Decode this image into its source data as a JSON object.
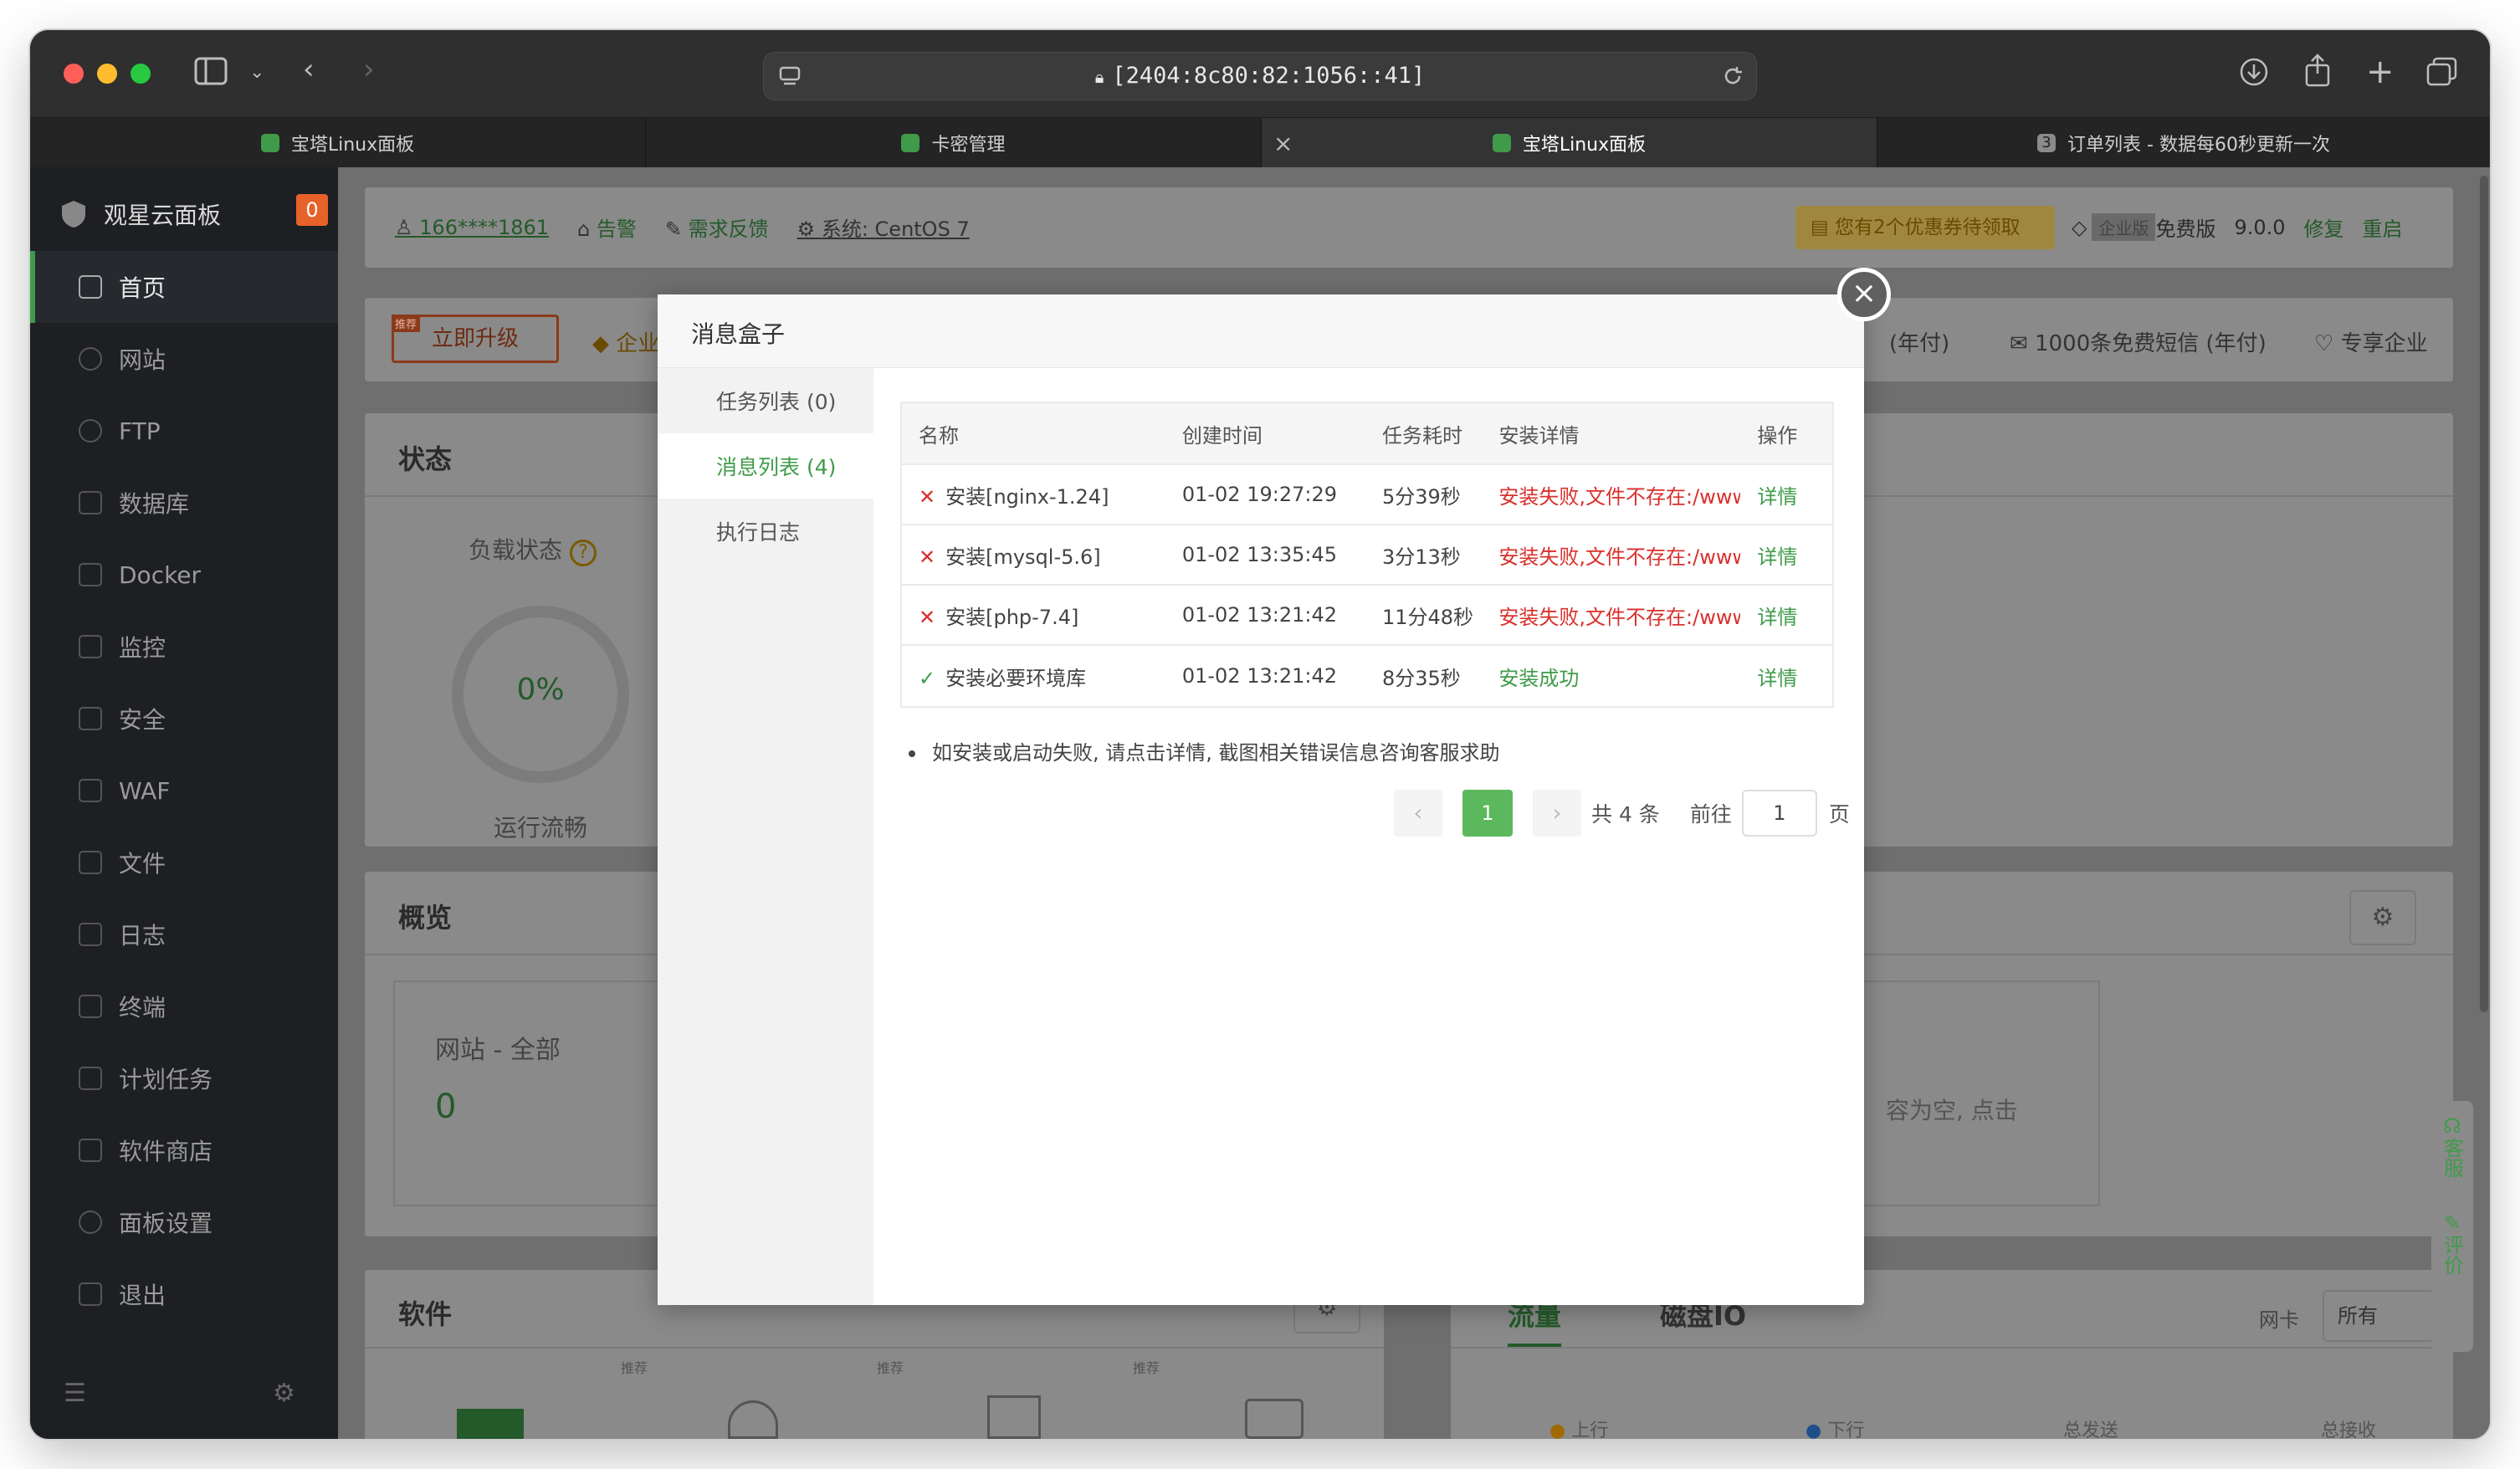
{
  "browser": {
    "url": "[2404:8c80:82:1056::41]",
    "tabs": [
      {
        "title": "宝塔Linux面板",
        "favicon_color": "#3f9b4a",
        "active": false
      },
      {
        "title": "卡密管理",
        "favicon_color": "#3f9b4a",
        "active": false
      },
      {
        "title": "宝塔Linux面板",
        "favicon_color": "#3f9b4a",
        "active": true,
        "close": "×"
      },
      {
        "title": "订单列表 - 数据每60秒更新一次",
        "favicon_badge": "3",
        "active": false
      }
    ]
  },
  "sidebar": {
    "brand": "观星云面板",
    "badge": "0",
    "items": [
      {
        "label": "首页",
        "active": true
      },
      {
        "label": "网站"
      },
      {
        "label": "FTP"
      },
      {
        "label": "数据库"
      },
      {
        "label": "Docker"
      },
      {
        "label": "监控"
      },
      {
        "label": "安全"
      },
      {
        "label": "WAF"
      },
      {
        "label": "文件"
      },
      {
        "label": "日志"
      },
      {
        "label": "终端"
      },
      {
        "label": "计划任务"
      },
      {
        "label": "软件商店"
      },
      {
        "label": "面板设置"
      },
      {
        "label": "退出"
      }
    ]
  },
  "header": {
    "user": "166****1861",
    "alert": "告警",
    "feedback": "需求反馈",
    "system": "系统: CentOS 7",
    "coupon": "您有2个优惠券待领取",
    "edition_tag": "企业版",
    "edition": "免费版",
    "version": "9.0.0",
    "repair": "修复",
    "restart": "重启"
  },
  "promo": {
    "upgrade": "立即升级",
    "recommend_tag": "推荐",
    "enterprise": "企业",
    "yearly": "(年付)",
    "sms": "1000条免费短信 (年付)",
    "exclusive": "专享企业"
  },
  "status_panel": {
    "title": "状态",
    "load_label": "负载状态",
    "load_value": "0%",
    "load_state": "运行流畅"
  },
  "overview_panel": {
    "title": "概览",
    "site_label": "网站 - 全部",
    "site_value": "0",
    "empty_hint": "容为空, 点击"
  },
  "software_panel": {
    "title": "软件",
    "recommend_tag": "推荐"
  },
  "traffic_panel": {
    "tab_traffic": "流量",
    "tab_disk": "磁盘IO",
    "nic_label": "网卡",
    "nic_value": "所有",
    "up": "上行",
    "down": "下行",
    "sent": "总发送",
    "recv": "总接收"
  },
  "float": {
    "service": "客服",
    "rate": "评价"
  },
  "modal": {
    "title": "消息盒子",
    "close": "×",
    "tabs": [
      {
        "label": "任务列表 (0)",
        "active": false
      },
      {
        "label": "消息列表 (4)",
        "active": true
      },
      {
        "label": "执行日志",
        "active": false
      }
    ],
    "table": {
      "headers": [
        "名称",
        "创建时间",
        "任务耗时",
        "安装详情",
        "操作"
      ],
      "rows": [
        {
          "status": "fail",
          "name": "安装[nginx-1.24]",
          "time": "01-02 19:27:29",
          "duration": "5分39秒",
          "detail": "安装失败,文件不存在:/www",
          "action": "详情"
        },
        {
          "status": "fail",
          "name": "安装[mysql-5.6]",
          "time": "01-02 13:35:45",
          "duration": "3分13秒",
          "detail": "安装失败,文件不存在:/www",
          "action": "详情"
        },
        {
          "status": "fail",
          "name": "安装[php-7.4]",
          "time": "01-02 13:21:42",
          "duration": "11分48秒",
          "detail": "安装失败,文件不存在:/www",
          "action": "详情"
        },
        {
          "status": "ok",
          "name": "安装必要环境库",
          "time": "01-02 13:21:42",
          "duration": "8分35秒",
          "detail": "安装成功",
          "action": "详情"
        }
      ]
    },
    "note": "如安装或启动失败, 请点击详情, 截图相关错误信息咨询客服求助",
    "pager": {
      "current": "1",
      "total": "共 4 条",
      "goto": "前往",
      "page_value": "1",
      "page_unit": "页"
    }
  }
}
